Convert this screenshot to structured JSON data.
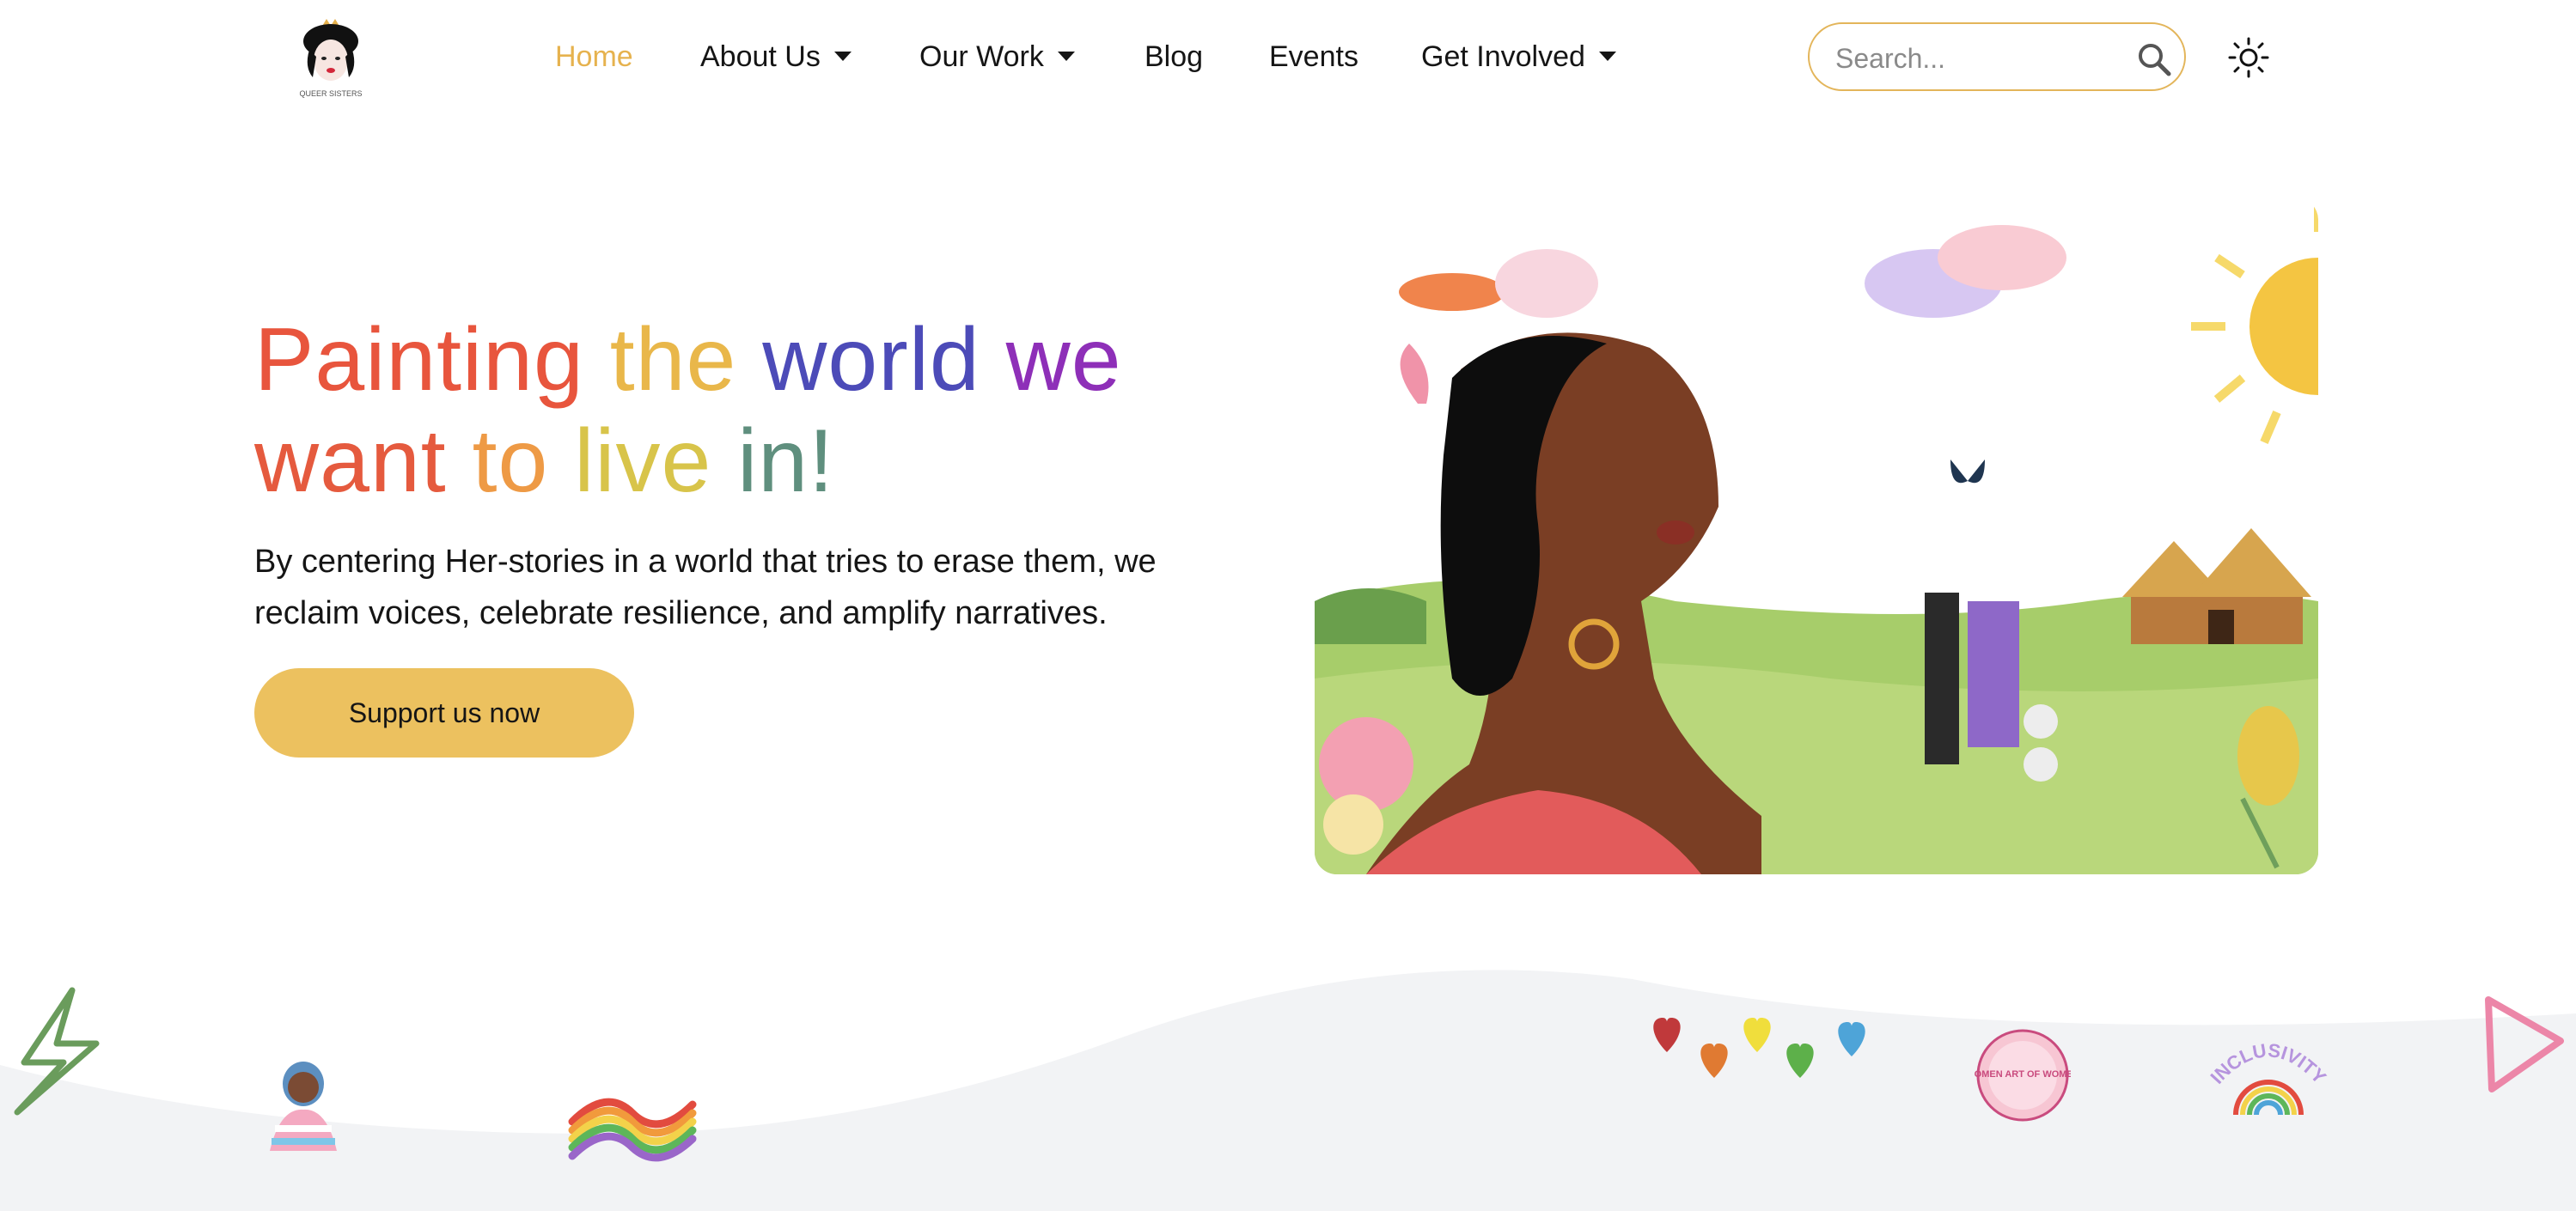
{
  "nav": {
    "logo_icon": "crowned-queen-logo",
    "logo_text": "QUEER SISTERS",
    "items": [
      {
        "label": "Home",
        "active": true,
        "dropdown": false
      },
      {
        "label": "About Us",
        "active": false,
        "dropdown": true
      },
      {
        "label": "Our Work",
        "active": false,
        "dropdown": true
      },
      {
        "label": "Blog",
        "active": false,
        "dropdown": false
      },
      {
        "label": "Events",
        "active": false,
        "dropdown": false
      },
      {
        "label": "Get Involved",
        "active": false,
        "dropdown": true
      }
    ],
    "search": {
      "placeholder": "Search...",
      "value": "",
      "icon": "search-icon"
    },
    "theme_toggle_icon": "sun-icon"
  },
  "hero": {
    "headline_words": [
      {
        "text": "Painting",
        "color": "#E8553D"
      },
      {
        "text": "the",
        "color": "#E9B74A"
      },
      {
        "text": "world",
        "color": "#4C4BB8"
      },
      {
        "text": "we",
        "color": "#8E2FB8"
      },
      {
        "text": "want",
        "color": "#E55A3E"
      },
      {
        "text": "to",
        "color": "#EE9A45"
      },
      {
        "text": "live",
        "color": "#D8C44A"
      },
      {
        "text": "in!",
        "color": "#5F8F7E"
      }
    ],
    "subtitle": "By centering Her-stories in a world that tries to erase them, we reclaim voices, celebrate resilience, and amplify narratives.",
    "cta_label": "Support us now",
    "illustration": "woman-in-meadow-illustration"
  },
  "colors": {
    "accent": "#ECC15F",
    "active_nav": "#E6B24E",
    "wave": "#F2F3F5"
  },
  "stickers": [
    "lightning-bolt-icon",
    "trans-flag-person-sticker",
    "rainbow-flag-sticker",
    "colorful-hearts-sticker",
    "women-art-sticker",
    "inclusivity-rainbow-sticker",
    "play-triangle-icon"
  ],
  "sticker_text": {
    "women": "WOMEN ART OF WOMEN",
    "inclusivity": "INCLUSIVITY"
  }
}
